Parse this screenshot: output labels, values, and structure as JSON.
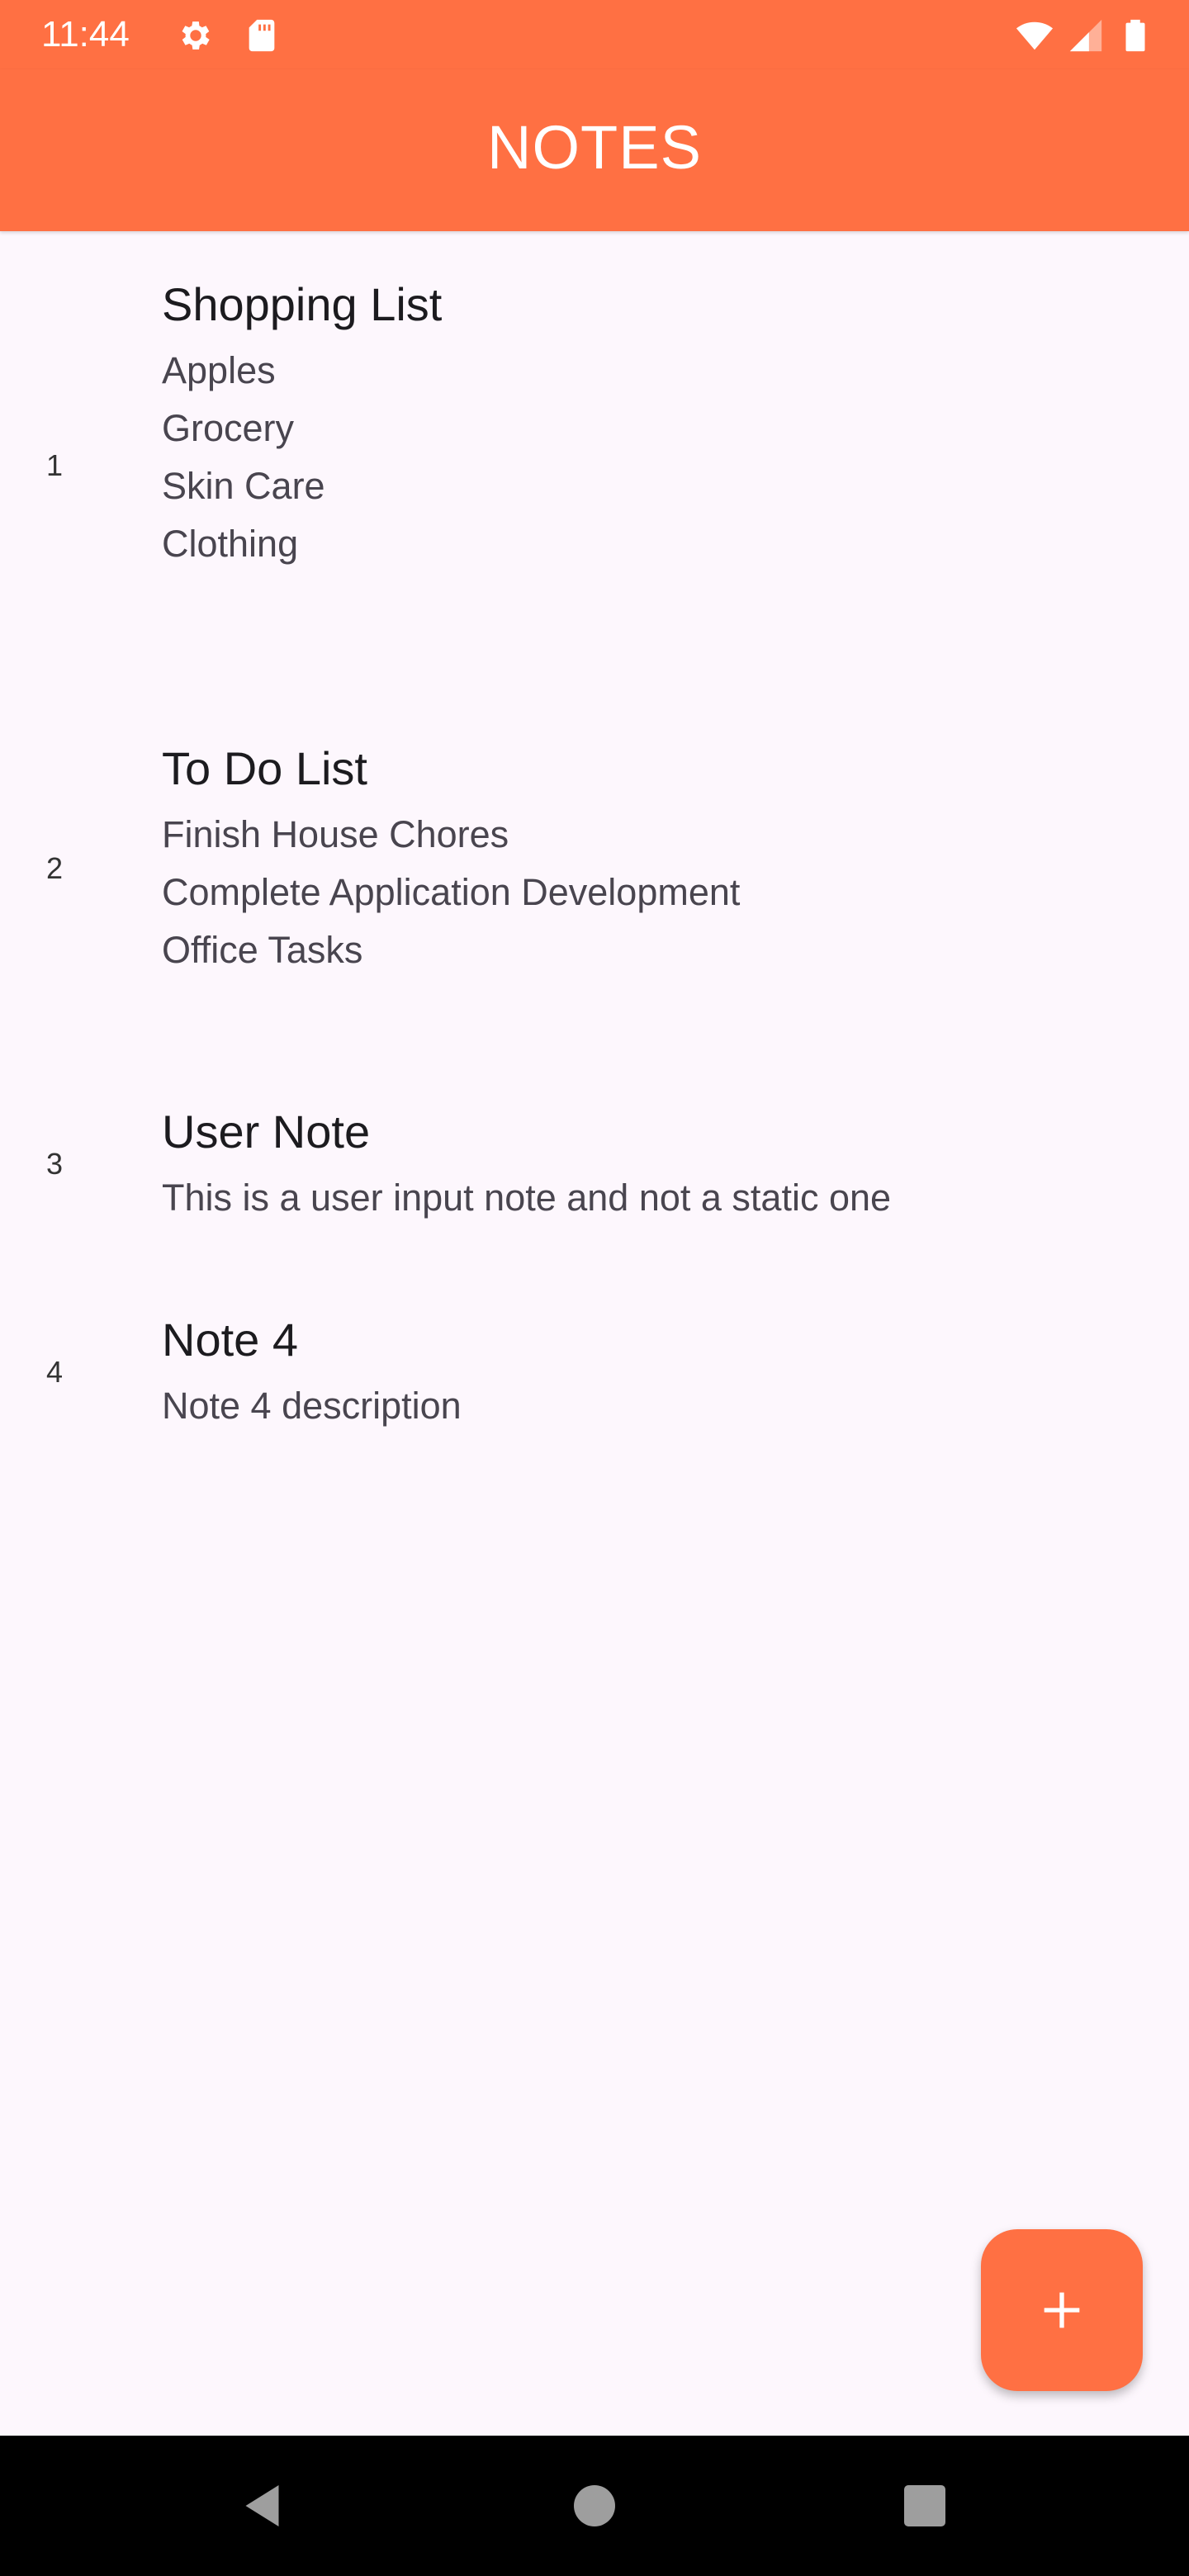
{
  "status_bar": {
    "time": "11:44",
    "icons": [
      "settings-icon",
      "sd-card-icon",
      "wifi-icon",
      "cell-signal-icon",
      "battery-icon"
    ]
  },
  "app_bar": {
    "title": "NOTES",
    "color": "#ff7043"
  },
  "notes": [
    {
      "number": "1",
      "title": "Shopping List",
      "lines": [
        "Apples",
        "Grocery",
        "Skin Care",
        "Clothing"
      ]
    },
    {
      "number": "2",
      "title": "To Do List",
      "lines": [
        "Finish House Chores",
        "Complete Application Development",
        "Office Tasks"
      ]
    },
    {
      "number": "3",
      "title": "User Note",
      "lines": [
        "This is a user input note and not a static one"
      ]
    },
    {
      "number": "4",
      "title": "Note 4",
      "lines": [
        "Note 4 description"
      ]
    }
  ],
  "fab": {
    "icon": "plus-icon"
  },
  "nav_bar": {
    "icons": [
      "back-icon",
      "home-icon",
      "recents-icon"
    ]
  }
}
